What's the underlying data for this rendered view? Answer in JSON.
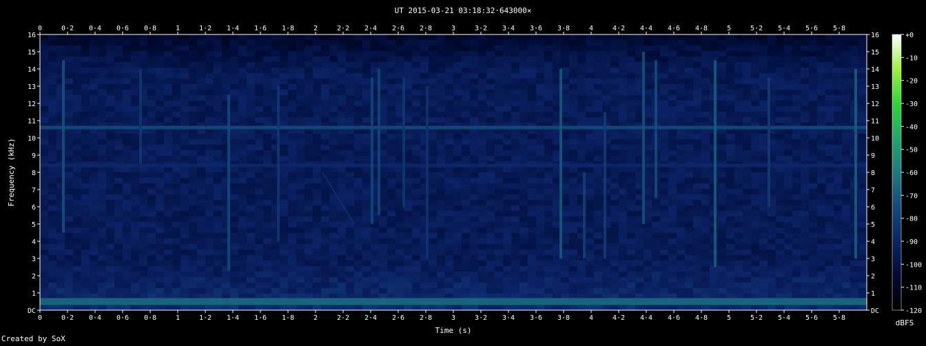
{
  "chart_data": {
    "type": "heatmap",
    "title": "UT 2015-03-21 03:18:32·643000×",
    "xlabel": "Time (s)",
    "ylabel": "Frequency (kHz)",
    "credit": "Created by SoX",
    "colorbar_label": "dBFS",
    "xlim": [
      0,
      6.0
    ],
    "ylim": [
      0,
      16
    ],
    "x_ticks": [
      "0",
      "0·2",
      "0·4",
      "0·6",
      "0·8",
      "1",
      "1·2",
      "1·4",
      "1·6",
      "1·8",
      "2",
      "2·2",
      "2·4",
      "2·6",
      "2·8",
      "3",
      "3·2",
      "3·4",
      "3·6",
      "3·8",
      "4",
      "4·2",
      "4·4",
      "4·6",
      "4·8",
      "5",
      "5·2",
      "5·4",
      "5·6",
      "5·8"
    ],
    "x_tick_values": [
      0,
      0.2,
      0.4,
      0.6,
      0.8,
      1.0,
      1.2,
      1.4,
      1.6,
      1.8,
      2.0,
      2.2,
      2.4,
      2.6,
      2.8,
      3.0,
      3.2,
      3.4,
      3.6,
      3.8,
      4.0,
      4.2,
      4.4,
      4.6,
      4.8,
      5.0,
      5.2,
      5.4,
      5.6,
      5.8
    ],
    "y_ticks": [
      "DC",
      "1",
      "2",
      "3",
      "4",
      "5",
      "6",
      "7",
      "8",
      "9",
      "10",
      "11",
      "12",
      "13",
      "14",
      "15",
      "16"
    ],
    "y_tick_values": [
      0,
      1,
      2,
      3,
      4,
      5,
      6,
      7,
      8,
      9,
      10,
      11,
      12,
      13,
      14,
      15,
      16
    ],
    "colorbar_ticks": [
      "+0",
      "-10",
      "-20",
      "-30",
      "-40",
      "-50",
      "-60",
      "-70",
      "-80",
      "-90",
      "-100",
      "-110",
      "-120"
    ],
    "colorbar_values": [
      0,
      -10,
      -20,
      -30,
      -40,
      -50,
      -60,
      -70,
      -80,
      -90,
      -100,
      -110,
      -120
    ],
    "colorbar_range": [
      -120,
      0
    ],
    "background_level_dbfs": -95,
    "features": {
      "horizontal_lines": [
        {
          "freq_khz": 10.6,
          "level_dbfs": -75
        },
        {
          "freq_khz": 0.5,
          "level_dbfs": -65
        },
        {
          "freq_khz": 8.4,
          "level_dbfs": -88
        }
      ],
      "vertical_events": [
        {
          "t": 0.17,
          "f_lo": 4.5,
          "f_hi": 14.5,
          "level_dbfs": -72
        },
        {
          "t": 0.73,
          "f_lo": 8.5,
          "f_hi": 14.0,
          "level_dbfs": -82
        },
        {
          "t": 1.37,
          "f_lo": 2.3,
          "f_hi": 12.5,
          "level_dbfs": -75
        },
        {
          "t": 1.73,
          "f_lo": 4.0,
          "f_hi": 13.0,
          "level_dbfs": -82
        },
        {
          "t": 2.41,
          "f_lo": 5.0,
          "f_hi": 13.5,
          "level_dbfs": -76
        },
        {
          "t": 2.46,
          "f_lo": 5.5,
          "f_hi": 14.0,
          "level_dbfs": -76
        },
        {
          "t": 2.64,
          "f_lo": 6.0,
          "f_hi": 13.5,
          "level_dbfs": -82
        },
        {
          "t": 2.81,
          "f_lo": 3.0,
          "f_hi": 13.0,
          "level_dbfs": -84
        },
        {
          "t": 3.78,
          "f_lo": 3.0,
          "f_hi": 14.0,
          "level_dbfs": -70
        },
        {
          "t": 3.95,
          "f_lo": 3.0,
          "f_hi": 8.0,
          "level_dbfs": -78
        },
        {
          "t": 4.1,
          "f_lo": 3.0,
          "f_hi": 11.5,
          "level_dbfs": -80
        },
        {
          "t": 4.38,
          "f_lo": 5.0,
          "f_hi": 15.0,
          "level_dbfs": -72
        },
        {
          "t": 4.47,
          "f_lo": 6.5,
          "f_hi": 14.5,
          "level_dbfs": -74
        },
        {
          "t": 4.9,
          "f_lo": 2.5,
          "f_hi": 14.5,
          "level_dbfs": -68
        },
        {
          "t": 5.29,
          "f_lo": 6.0,
          "f_hi": 13.5,
          "level_dbfs": -80
        },
        {
          "t": 5.92,
          "f_lo": 3.0,
          "f_hi": 14.0,
          "level_dbfs": -68
        }
      ],
      "sweep": {
        "t_start": 2.05,
        "t_end": 2.28,
        "f_start": 8.0,
        "f_end": 5.0,
        "level_dbfs": -86
      }
    }
  },
  "colors": {
    "background": "#000000",
    "axis": "#ffffff",
    "colormap": [
      "#000000",
      "#000b36",
      "#0b2366",
      "#134a7c",
      "#1e7a80",
      "#21a86a",
      "#2fd43a",
      "#9ef040",
      "#ffffff"
    ]
  }
}
